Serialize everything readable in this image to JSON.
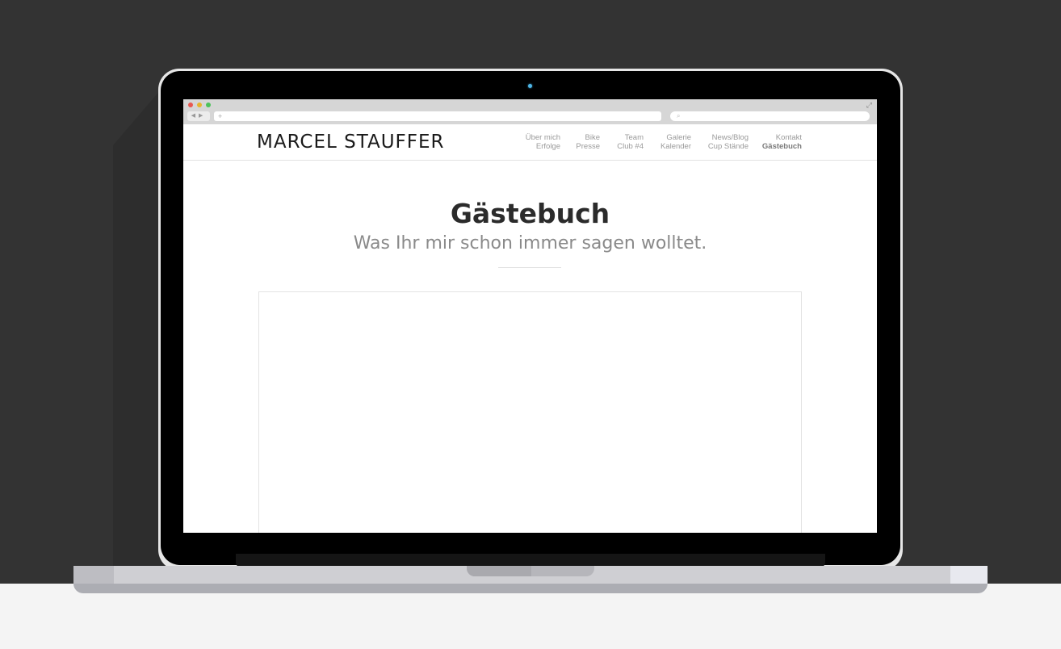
{
  "site": {
    "logo_text": "MARCEL STAUFFER"
  },
  "browser": {
    "back_icon": "◀",
    "forward_icon": "▶",
    "new_tab_icon": "+",
    "search_icon": "⌕",
    "expand_icon": "⤢"
  },
  "nav": {
    "items": [
      {
        "top": "Über mich",
        "bottom": "Erfolge"
      },
      {
        "top": "Bike",
        "bottom": "Presse"
      },
      {
        "top": "Team",
        "bottom": "Club #4"
      },
      {
        "top": "Galerie",
        "bottom": "Kalender"
      },
      {
        "top": "News/Blog",
        "bottom": "Cup Stände"
      },
      {
        "top": "Kontakt",
        "bottom": "Gästebuch"
      }
    ]
  },
  "page": {
    "title": "Gästebuch",
    "subtitle": "Was Ihr mir schon immer sagen wolltet."
  },
  "colors": {
    "background": "#333333",
    "floor": "#f4f4f4",
    "camera": "#4fb6e6"
  }
}
